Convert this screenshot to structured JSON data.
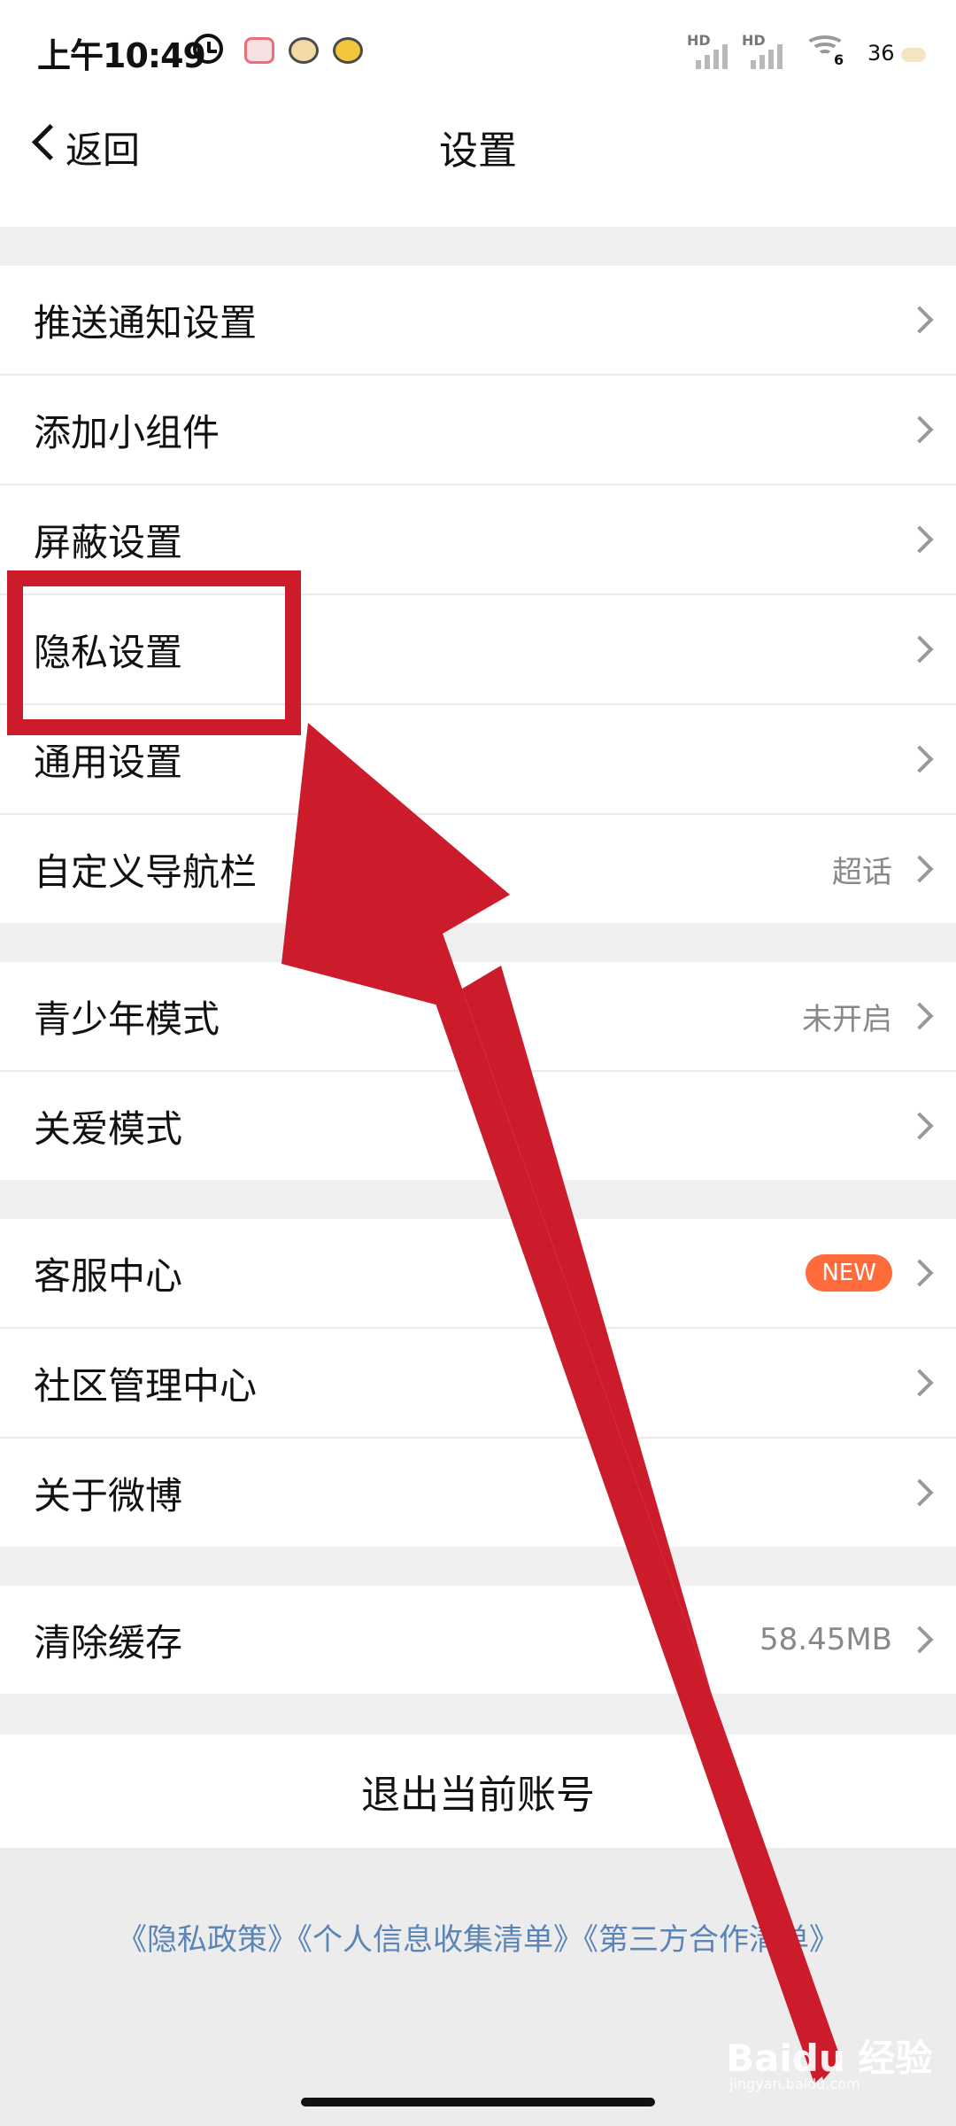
{
  "status_bar": {
    "time": "上午10:49",
    "sim1": "HD",
    "sim2": "HD",
    "wifi_label": "6",
    "battery": "36",
    "icons": [
      "alarm-icon",
      "app-icon-a",
      "app-icon-b",
      "app-icon-c",
      "signal-icon",
      "wifi-icon",
      "battery-icon"
    ]
  },
  "header": {
    "back_label": "返回",
    "title": "设置"
  },
  "section1": [
    {
      "label": "推送通知设置",
      "value": ""
    },
    {
      "label": "添加小组件",
      "value": ""
    },
    {
      "label": "屏蔽设置",
      "value": ""
    },
    {
      "label": "隐私设置",
      "value": ""
    },
    {
      "label": "通用设置",
      "value": ""
    },
    {
      "label": "自定义导航栏",
      "value": "超话"
    }
  ],
  "section2": [
    {
      "label": "青少年模式",
      "value": "未开启"
    },
    {
      "label": "关爱模式",
      "value": ""
    }
  ],
  "section3": [
    {
      "label": "客服中心",
      "badge": "NEW"
    },
    {
      "label": "社区管理中心",
      "value": ""
    },
    {
      "label": "关于微博",
      "value": ""
    }
  ],
  "section4": [
    {
      "label": "清除缓存",
      "value": "58.45MB"
    }
  ],
  "logout_label": "退出当前账号",
  "footer_links": "《隐私政策》《个人信息收集清单》《第三方合作清单》",
  "watermark": {
    "text": "Baidu 经验",
    "sub": "jingyan.baidu.com"
  },
  "colors": {
    "accent_red": "#cc1b2a",
    "badge_orange": "#ff6b3a",
    "link_blue": "#5b84b7",
    "gap_gray": "#efefef"
  }
}
